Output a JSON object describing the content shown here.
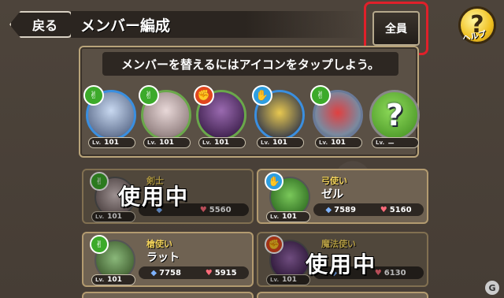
{
  "header": {
    "back_label": "戻る",
    "title": "メンバー編成",
    "all_label": "全員",
    "help_label": "ヘルプ",
    "help_symbol": "?"
  },
  "team": {
    "instruction": "メンバーを替えるにはアイコンをタップしよう。",
    "members": [
      {
        "element": "green",
        "level_label": "Lv.",
        "level": "101"
      },
      {
        "element": "green",
        "level_label": "Lv.",
        "level": "101"
      },
      {
        "element": "red",
        "level_label": "Lv.",
        "level": "101"
      },
      {
        "element": "blue",
        "level_label": "Lv.",
        "level": "101"
      },
      {
        "element": "green",
        "level_label": "Lv.",
        "level": "101"
      },
      {
        "element": "empty",
        "level_label": "Lv.",
        "level": "－",
        "symbol": "?"
      }
    ]
  },
  "roster": [
    {
      "class": "剣士",
      "name": "",
      "level_label": "Lv.",
      "level": "101",
      "attack": "",
      "hp": "5560",
      "in_use": true,
      "in_use_label": "使用中",
      "element": "green"
    },
    {
      "class": "弓使い",
      "name": "ゼル",
      "level_label": "Lv.",
      "level": "101",
      "attack": "7589",
      "hp": "5160",
      "in_use": false,
      "element": "blue"
    },
    {
      "class": "槍使い",
      "name": "ラット",
      "level_label": "Lv.",
      "level": "101",
      "attack": "7758",
      "hp": "5915",
      "in_use": false,
      "element": "green"
    },
    {
      "class": "魔法使い",
      "name": "",
      "level_label": "Lv.",
      "level": "101",
      "attack": "",
      "hp": "6130",
      "in_use": true,
      "in_use_label": "使用中",
      "element": "red"
    }
  ],
  "watermark": "G"
}
